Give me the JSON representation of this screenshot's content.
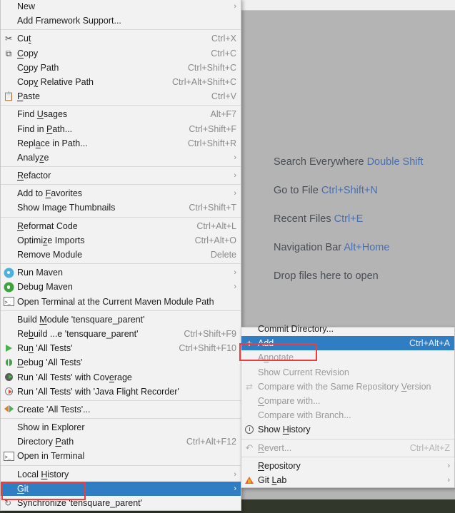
{
  "editor_hints": [
    {
      "label": "Search Everywhere ",
      "key": "Double Shift"
    },
    {
      "label": "Go to File ",
      "key": "Ctrl+Shift+N"
    },
    {
      "label": "Recent Files ",
      "key": "Ctrl+E"
    },
    {
      "label": "Navigation Bar ",
      "key": "Alt+Home"
    },
    {
      "label": "Drop files here to open",
      "key": ""
    }
  ],
  "context_menu": {
    "name": "project-context-menu",
    "items": [
      {
        "label": "New",
        "accel": "",
        "arrow": true,
        "icon": "",
        "mnemonic": -1
      },
      {
        "label": "Add Framework Support...",
        "accel": "",
        "arrow": false,
        "icon": "",
        "mnemonic": -1
      },
      {
        "sep": true
      },
      {
        "label": "Cut",
        "accel": "Ctrl+X",
        "arrow": false,
        "icon": "scissors-icon",
        "mnemonic": 2
      },
      {
        "label": "Copy",
        "accel": "Ctrl+C",
        "arrow": false,
        "icon": "copy-icon",
        "mnemonic": 0
      },
      {
        "label": "Copy Path",
        "accel": "Ctrl+Shift+C",
        "arrow": false,
        "icon": "",
        "mnemonic": 1
      },
      {
        "label": "Copy Relative Path",
        "accel": "Ctrl+Alt+Shift+C",
        "arrow": false,
        "icon": "",
        "mnemonic": 3
      },
      {
        "label": "Paste",
        "accel": "Ctrl+V",
        "arrow": false,
        "icon": "paste-icon",
        "mnemonic": 0
      },
      {
        "sep": true
      },
      {
        "label": "Find Usages",
        "accel": "Alt+F7",
        "arrow": false,
        "icon": "",
        "mnemonic": 5
      },
      {
        "label": "Find in Path...",
        "accel": "Ctrl+Shift+F",
        "arrow": false,
        "icon": "",
        "mnemonic": 8
      },
      {
        "label": "Replace in Path...",
        "accel": "Ctrl+Shift+R",
        "arrow": false,
        "icon": "",
        "mnemonic": 4
      },
      {
        "label": "Analyze",
        "accel": "",
        "arrow": true,
        "icon": "",
        "mnemonic": 5
      },
      {
        "sep": true
      },
      {
        "label": "Refactor",
        "accel": "",
        "arrow": true,
        "icon": "",
        "mnemonic": 0
      },
      {
        "sep": true
      },
      {
        "label": "Add to Favorites",
        "accel": "",
        "arrow": true,
        "icon": "",
        "mnemonic": 7
      },
      {
        "label": "Show Image Thumbnails",
        "accel": "Ctrl+Shift+T",
        "arrow": false,
        "icon": "",
        "mnemonic": -1
      },
      {
        "sep": true
      },
      {
        "label": "Reformat Code",
        "accel": "Ctrl+Alt+L",
        "arrow": false,
        "icon": "",
        "mnemonic": 0
      },
      {
        "label": "Optimize Imports",
        "accel": "Ctrl+Alt+O",
        "arrow": false,
        "icon": "",
        "mnemonic": 6
      },
      {
        "label": "Remove Module",
        "accel": "Delete",
        "arrow": false,
        "icon": "",
        "mnemonic": -1
      },
      {
        "sep": true
      },
      {
        "label": "Run Maven",
        "accel": "",
        "arrow": true,
        "icon": "maven-run-icon",
        "mnemonic": -1
      },
      {
        "label": "Debug Maven",
        "accel": "",
        "arrow": true,
        "icon": "maven-debug-icon",
        "mnemonic": -1
      },
      {
        "label": "Open Terminal at the Current Maven Module Path",
        "accel": "",
        "arrow": false,
        "icon": "terminal-icon",
        "mnemonic": -1
      },
      {
        "sep": true
      },
      {
        "label": "Build Module 'tensquare_parent'",
        "accel": "",
        "arrow": false,
        "icon": "",
        "mnemonic": 6
      },
      {
        "label": "Rebuild ...e 'tensquare_parent'",
        "accel": "Ctrl+Shift+F9",
        "arrow": false,
        "icon": "",
        "mnemonic": 2
      },
      {
        "label": "Run 'All Tests'",
        "accel": "Ctrl+Shift+F10",
        "arrow": false,
        "icon": "run-icon",
        "mnemonic": 2
      },
      {
        "label": "Debug 'All Tests'",
        "accel": "",
        "arrow": false,
        "icon": "debug-icon",
        "mnemonic": 0
      },
      {
        "label": "Run 'All Tests' with Coverage",
        "accel": "",
        "arrow": false,
        "icon": "coverage-icon",
        "mnemonic": 24
      },
      {
        "label": "Run 'All Tests' with 'Java Flight Recorder'",
        "accel": "",
        "arrow": false,
        "icon": "jfr-icon",
        "mnemonic": -1
      },
      {
        "sep": true
      },
      {
        "label": "Create 'All Tests'...",
        "accel": "",
        "arrow": false,
        "icon": "create-config-icon",
        "mnemonic": -1
      },
      {
        "sep": true
      },
      {
        "label": "Show in Explorer",
        "accel": "",
        "arrow": false,
        "icon": "",
        "mnemonic": -1
      },
      {
        "label": "Directory Path",
        "accel": "Ctrl+Alt+F12",
        "arrow": false,
        "icon": "",
        "mnemonic": 10
      },
      {
        "label": "Open in Terminal",
        "accel": "",
        "arrow": false,
        "icon": "terminal-icon",
        "mnemonic": -1
      },
      {
        "sep": true
      },
      {
        "label": "Local History",
        "accel": "",
        "arrow": true,
        "icon": "",
        "mnemonic": 6
      },
      {
        "label": "Git",
        "accel": "",
        "arrow": true,
        "icon": "",
        "mnemonic": 0,
        "selected": true,
        "highlighted": true
      },
      {
        "label": "Synchronize 'tensquare_parent'",
        "accel": "",
        "arrow": false,
        "icon": "sync-icon",
        "mnemonic": -1
      }
    ]
  },
  "git_submenu": {
    "name": "git-submenu",
    "items": [
      {
        "label": "Commit Directory...",
        "accel": "",
        "arrow": false,
        "icon": "",
        "mnemonic": -1,
        "clipped": true
      },
      {
        "label": "Add",
        "accel": "Ctrl+Alt+A",
        "arrow": false,
        "icon": "add-icon",
        "mnemonic": -1,
        "selected": true,
        "highlighted": true
      },
      {
        "label": "Annotate",
        "accel": "",
        "arrow": false,
        "icon": "",
        "mnemonic": 1,
        "disabled": true
      },
      {
        "label": "Show Current Revision",
        "accel": "",
        "arrow": false,
        "icon": "",
        "mnemonic": -1,
        "disabled": true
      },
      {
        "label": "Compare with the Same Repository Version",
        "accel": "",
        "arrow": false,
        "icon": "compare-icon",
        "mnemonic": 33,
        "disabled": true
      },
      {
        "label": "Compare with...",
        "accel": "",
        "arrow": false,
        "icon": "",
        "mnemonic": 0,
        "disabled": true
      },
      {
        "label": "Compare with Branch...",
        "accel": "",
        "arrow": false,
        "icon": "",
        "mnemonic": -1,
        "disabled": true
      },
      {
        "label": "Show History",
        "accel": "",
        "arrow": false,
        "icon": "history-icon",
        "mnemonic": 5
      },
      {
        "sep": true
      },
      {
        "label": "Revert...",
        "accel": "Ctrl+Alt+Z",
        "arrow": false,
        "icon": "revert-icon",
        "mnemonic": 0,
        "disabled": true
      },
      {
        "sep": true
      },
      {
        "label": "Repository",
        "accel": "",
        "arrow": true,
        "icon": "",
        "mnemonic": 0
      },
      {
        "label": "Git Lab",
        "accel": "",
        "arrow": true,
        "icon": "gitlab-icon",
        "mnemonic": 4
      }
    ]
  },
  "colors": {
    "selection": "#2f7ec4",
    "annotation_box": "#f23b3b",
    "menu_background": "#f2f2f2",
    "editor_background": "#b4b4b4",
    "hint_key": "#4a6fb0"
  }
}
